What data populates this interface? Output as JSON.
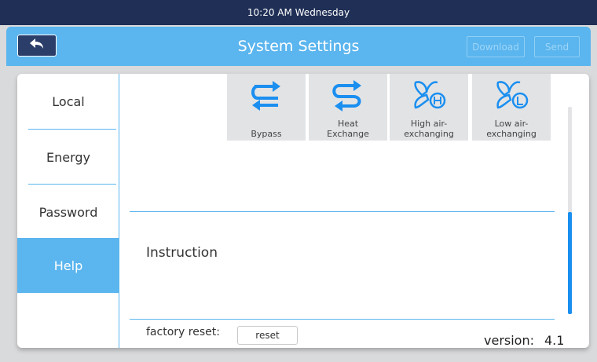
{
  "status_bar": {
    "time_text": "10:20 AM Wednesday"
  },
  "header": {
    "title": "System Settings",
    "back_icon": "back-arrow-icon",
    "download_label": "Download",
    "send_label": "Send"
  },
  "sidebar": {
    "items": [
      {
        "label": "Local"
      },
      {
        "label": "Energy"
      },
      {
        "label": "Password"
      },
      {
        "label": "Help",
        "active": true
      }
    ]
  },
  "modes": [
    {
      "label_line1": "Bypass",
      "label_line2": "",
      "icon": "bypass-arrows-icon"
    },
    {
      "label_line1": "Heat",
      "label_line2": "Exchange",
      "icon": "heat-exchange-icon"
    },
    {
      "label_line1": "High air-",
      "label_line2": "exchanging",
      "icon": "fan-high-icon"
    },
    {
      "label_line1": "Low air-",
      "label_line2": "exchanging",
      "icon": "fan-low-icon"
    }
  ],
  "help": {
    "instruction_label": "Instruction",
    "factory_reset_label": "factory reset:",
    "reset_button_label": "reset",
    "version_label": "version:",
    "version_value": "4.1"
  },
  "colors": {
    "accent": "#5bb5ee",
    "status_bar": "#1f2f56",
    "icon_blue": "#1a8ff0",
    "scroll_thumb": "#1a8ff0"
  }
}
